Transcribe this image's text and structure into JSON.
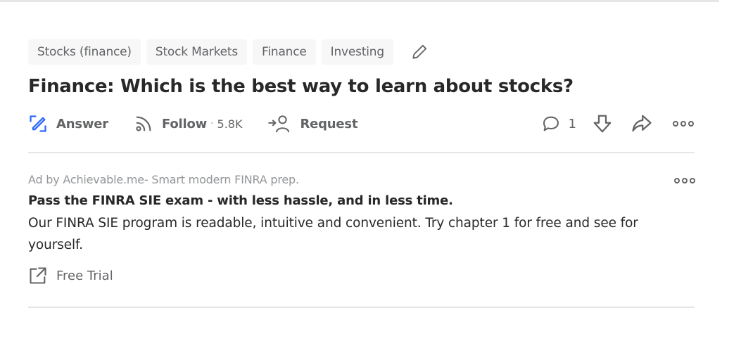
{
  "topics": [
    "Stocks (finance)",
    "Stock Markets",
    "Finance",
    "Investing"
  ],
  "question": {
    "title": "Finance: Which is the best way to learn about stocks?"
  },
  "actions": {
    "answer_label": "Answer",
    "follow_label": "Follow",
    "follow_separator": "·",
    "follow_count": "5.8K",
    "request_label": "Request",
    "comment_count": "1"
  },
  "ad": {
    "sponsor": "Ad by Achievable.me- Smart modern FINRA prep.",
    "headline": "Pass the FINRA SIE exam - with less hassle, and in less time.",
    "body": "Our FINRA SIE program is readable, intuitive and convenient. Try chapter 1 for free and see for yourself.",
    "cta_label": "Free Trial"
  },
  "colors": {
    "accent": "#2e69ff",
    "text": "#282829",
    "muted": "#636466",
    "topic_bg": "#f7f7f8",
    "divider": "#e6e6e6"
  }
}
